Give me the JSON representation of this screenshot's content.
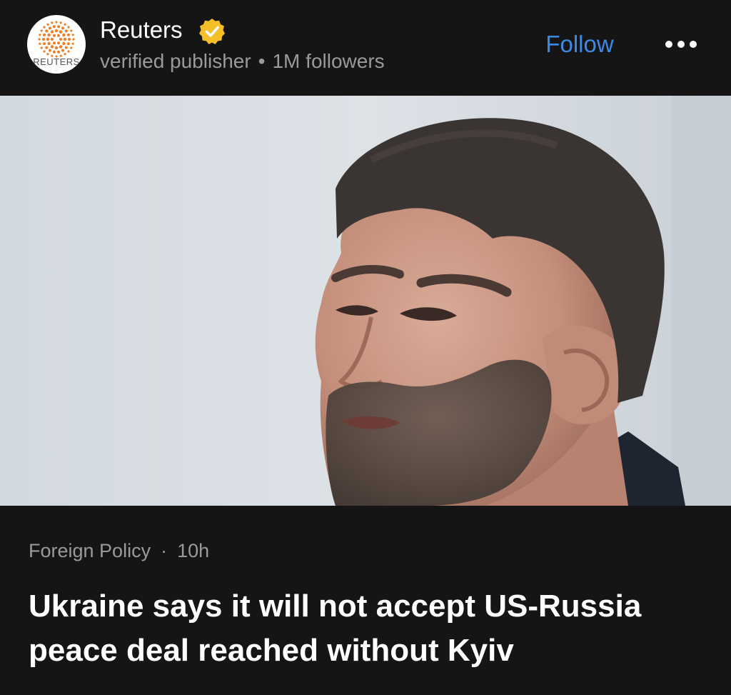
{
  "header": {
    "publisher_name": "Reuters",
    "avatar_text": "REUTERS",
    "verified_icon": "verified-badge-icon",
    "publisher_type": "verified publisher",
    "separator": "•",
    "followers": "1M followers",
    "follow_label": "Follow",
    "more_icon": "more-options-icon"
  },
  "article": {
    "image_subject": "man-portrait-photo",
    "category": "Foreign Policy",
    "separator": "·",
    "age": "10h",
    "headline": "Ukraine says it will not accept US-Russia peace deal reached without Kyiv"
  },
  "colors": {
    "background": "#151515",
    "accent": "#3d8ae6",
    "muted_text": "#9a9a9a",
    "verified_badge": "#f5bf2a",
    "reuters_orange": "#ef7d22"
  }
}
